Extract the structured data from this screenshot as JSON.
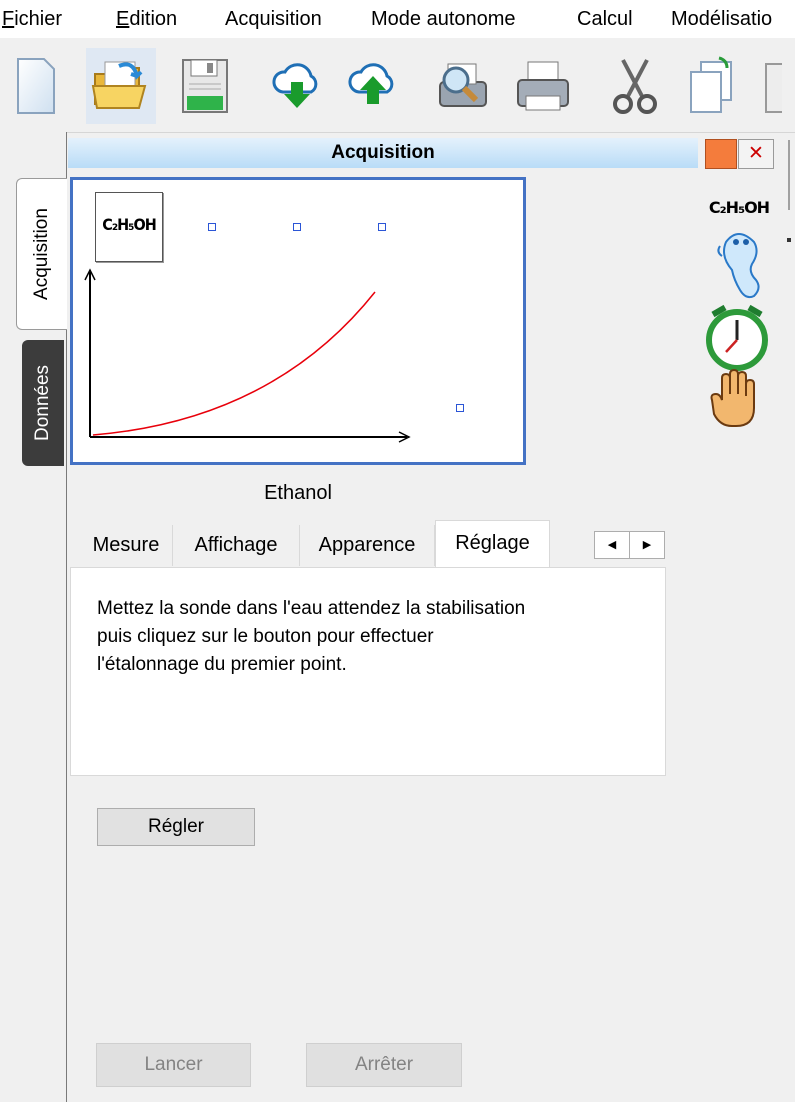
{
  "menu": {
    "items": [
      "Fichier",
      "Edition",
      "Acquisition",
      "Mode autonome",
      "Calcul",
      "Modélisatio"
    ],
    "underline": [
      "F",
      "E"
    ]
  },
  "toolbar": {
    "buttons": [
      "new-document-icon",
      "open-folder-icon",
      "save-icon",
      "download-cloud-icon",
      "upload-cloud-icon",
      "print-preview-icon",
      "print-icon",
      "cut-icon",
      "copy-icon",
      "paste-icon"
    ]
  },
  "side_tabs": {
    "acquisition": "Acquisition",
    "donnees": "Données"
  },
  "panel": {
    "title": "Acquisition",
    "sensor_formula": "C₂H₅OH",
    "sensor_name": "Ethanol"
  },
  "tabs": [
    "Mesure",
    "Affichage",
    "Apparence",
    "Réglage"
  ],
  "active_tab": "Réglage",
  "reglage": {
    "instructions": "Mettez la sonde dans l'eau attendez la stabilisation\npuis cliquez sur le bouton pour effectuer l'étalonnage du premier point.",
    "button_label": "Régler"
  },
  "actions": {
    "start": "Lancer",
    "stop": "Arrêter"
  },
  "right_panel": {
    "formula": "C₂H₅OH",
    "icons": [
      "ghost-icon",
      "stopwatch-icon",
      "hand-icon"
    ]
  },
  "colors": {
    "accent": "#4472c4",
    "header_top": "#e4f1fc",
    "header_bottom": "#b9dcf7",
    "curve": "#e8000b"
  }
}
